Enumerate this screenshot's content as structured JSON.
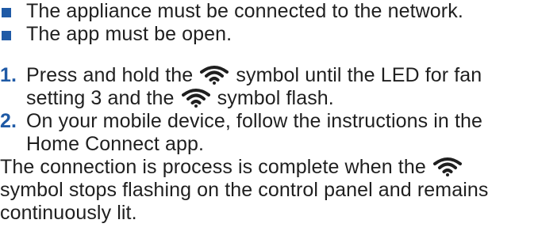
{
  "prerequisites": [
    "The appliance must be connected to the network.",
    "The app must be open."
  ],
  "steps": [
    {
      "number": "1.",
      "line1_before": "Press and hold the",
      "line1_after": "symbol until the LED for fan",
      "line2_before": "setting 3 and the",
      "line2_after": "symbol flash."
    },
    {
      "number": "2.",
      "line1": "On your mobile device, follow the instructions in the",
      "line2": "Home Connect app."
    }
  ],
  "completion": {
    "line1_before": "The connection is process is complete when the",
    "line2": "symbol stops flashing on the control panel and remains",
    "line3": "continuously lit."
  },
  "icons": {
    "wifi": "wifi-icon",
    "bullet": "square-bullet-icon"
  },
  "colors": {
    "accent": "#1f5aa6",
    "text": "#1f1f1f"
  }
}
